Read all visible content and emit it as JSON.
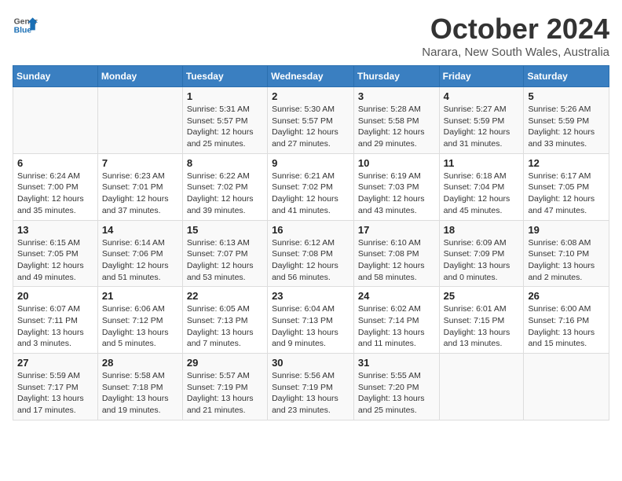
{
  "header": {
    "logo_line1": "General",
    "logo_line2": "Blue",
    "month_title": "October 2024",
    "subtitle": "Narara, New South Wales, Australia"
  },
  "days_of_week": [
    "Sunday",
    "Monday",
    "Tuesday",
    "Wednesday",
    "Thursday",
    "Friday",
    "Saturday"
  ],
  "weeks": [
    [
      {
        "day": "",
        "info": ""
      },
      {
        "day": "",
        "info": ""
      },
      {
        "day": "1",
        "info": "Sunrise: 5:31 AM\nSunset: 5:57 PM\nDaylight: 12 hours\nand 25 minutes."
      },
      {
        "day": "2",
        "info": "Sunrise: 5:30 AM\nSunset: 5:57 PM\nDaylight: 12 hours\nand 27 minutes."
      },
      {
        "day": "3",
        "info": "Sunrise: 5:28 AM\nSunset: 5:58 PM\nDaylight: 12 hours\nand 29 minutes."
      },
      {
        "day": "4",
        "info": "Sunrise: 5:27 AM\nSunset: 5:59 PM\nDaylight: 12 hours\nand 31 minutes."
      },
      {
        "day": "5",
        "info": "Sunrise: 5:26 AM\nSunset: 5:59 PM\nDaylight: 12 hours\nand 33 minutes."
      }
    ],
    [
      {
        "day": "6",
        "info": "Sunrise: 6:24 AM\nSunset: 7:00 PM\nDaylight: 12 hours\nand 35 minutes."
      },
      {
        "day": "7",
        "info": "Sunrise: 6:23 AM\nSunset: 7:01 PM\nDaylight: 12 hours\nand 37 minutes."
      },
      {
        "day": "8",
        "info": "Sunrise: 6:22 AM\nSunset: 7:02 PM\nDaylight: 12 hours\nand 39 minutes."
      },
      {
        "day": "9",
        "info": "Sunrise: 6:21 AM\nSunset: 7:02 PM\nDaylight: 12 hours\nand 41 minutes."
      },
      {
        "day": "10",
        "info": "Sunrise: 6:19 AM\nSunset: 7:03 PM\nDaylight: 12 hours\nand 43 minutes."
      },
      {
        "day": "11",
        "info": "Sunrise: 6:18 AM\nSunset: 7:04 PM\nDaylight: 12 hours\nand 45 minutes."
      },
      {
        "day": "12",
        "info": "Sunrise: 6:17 AM\nSunset: 7:05 PM\nDaylight: 12 hours\nand 47 minutes."
      }
    ],
    [
      {
        "day": "13",
        "info": "Sunrise: 6:15 AM\nSunset: 7:05 PM\nDaylight: 12 hours\nand 49 minutes."
      },
      {
        "day": "14",
        "info": "Sunrise: 6:14 AM\nSunset: 7:06 PM\nDaylight: 12 hours\nand 51 minutes."
      },
      {
        "day": "15",
        "info": "Sunrise: 6:13 AM\nSunset: 7:07 PM\nDaylight: 12 hours\nand 53 minutes."
      },
      {
        "day": "16",
        "info": "Sunrise: 6:12 AM\nSunset: 7:08 PM\nDaylight: 12 hours\nand 56 minutes."
      },
      {
        "day": "17",
        "info": "Sunrise: 6:10 AM\nSunset: 7:08 PM\nDaylight: 12 hours\nand 58 minutes."
      },
      {
        "day": "18",
        "info": "Sunrise: 6:09 AM\nSunset: 7:09 PM\nDaylight: 13 hours\nand 0 minutes."
      },
      {
        "day": "19",
        "info": "Sunrise: 6:08 AM\nSunset: 7:10 PM\nDaylight: 13 hours\nand 2 minutes."
      }
    ],
    [
      {
        "day": "20",
        "info": "Sunrise: 6:07 AM\nSunset: 7:11 PM\nDaylight: 13 hours\nand 3 minutes."
      },
      {
        "day": "21",
        "info": "Sunrise: 6:06 AM\nSunset: 7:12 PM\nDaylight: 13 hours\nand 5 minutes."
      },
      {
        "day": "22",
        "info": "Sunrise: 6:05 AM\nSunset: 7:13 PM\nDaylight: 13 hours\nand 7 minutes."
      },
      {
        "day": "23",
        "info": "Sunrise: 6:04 AM\nSunset: 7:13 PM\nDaylight: 13 hours\nand 9 minutes."
      },
      {
        "day": "24",
        "info": "Sunrise: 6:02 AM\nSunset: 7:14 PM\nDaylight: 13 hours\nand 11 minutes."
      },
      {
        "day": "25",
        "info": "Sunrise: 6:01 AM\nSunset: 7:15 PM\nDaylight: 13 hours\nand 13 minutes."
      },
      {
        "day": "26",
        "info": "Sunrise: 6:00 AM\nSunset: 7:16 PM\nDaylight: 13 hours\nand 15 minutes."
      }
    ],
    [
      {
        "day": "27",
        "info": "Sunrise: 5:59 AM\nSunset: 7:17 PM\nDaylight: 13 hours\nand 17 minutes."
      },
      {
        "day": "28",
        "info": "Sunrise: 5:58 AM\nSunset: 7:18 PM\nDaylight: 13 hours\nand 19 minutes."
      },
      {
        "day": "29",
        "info": "Sunrise: 5:57 AM\nSunset: 7:19 PM\nDaylight: 13 hours\nand 21 minutes."
      },
      {
        "day": "30",
        "info": "Sunrise: 5:56 AM\nSunset: 7:19 PM\nDaylight: 13 hours\nand 23 minutes."
      },
      {
        "day": "31",
        "info": "Sunrise: 5:55 AM\nSunset: 7:20 PM\nDaylight: 13 hours\nand 25 minutes."
      },
      {
        "day": "",
        "info": ""
      },
      {
        "day": "",
        "info": ""
      }
    ]
  ]
}
